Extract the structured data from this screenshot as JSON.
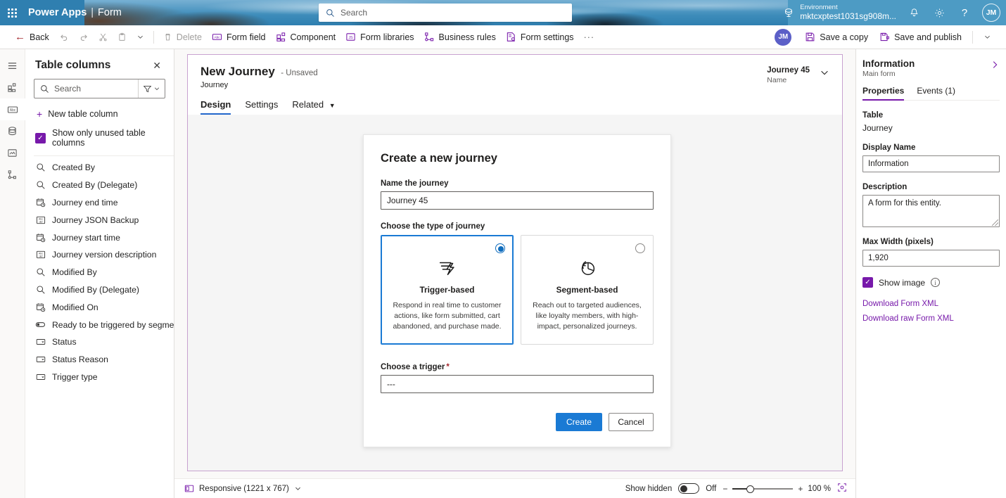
{
  "suitebar": {
    "waffle_label": "app-launcher",
    "brand": "Power Apps",
    "brand_separator": "|",
    "brand_sub": "Form",
    "search_placeholder": "Search",
    "environment_label": "Environment",
    "environment_name": "mktcxptest1031sg908m...",
    "avatar_initials": "JM"
  },
  "commandbar": {
    "back": "Back",
    "delete": "Delete",
    "form_field": "Form field",
    "component": "Component",
    "form_libraries": "Form libraries",
    "business_rules": "Business rules",
    "form_settings": "Form settings",
    "overflow": "···",
    "avatar_initials": "JM",
    "save_a_copy": "Save a copy",
    "save_and_publish": "Save and publish"
  },
  "rail": {
    "items": [
      {
        "name": "hamburger-icon",
        "label": "Menu"
      },
      {
        "name": "components-icon",
        "label": "Components"
      },
      {
        "name": "table-columns-icon",
        "label": "Table columns"
      },
      {
        "name": "data-sources-icon",
        "label": "Data sources"
      },
      {
        "name": "form-libraries-icon",
        "label": "Form libraries"
      },
      {
        "name": "business-rules-icon",
        "label": "Business rules"
      }
    ]
  },
  "columns_pane": {
    "title": "Table columns",
    "close_label": "Close",
    "search_placeholder": "Search",
    "new_column": "New table column",
    "show_unused_label": "Show only unused table columns",
    "show_unused_checked": true,
    "items": [
      {
        "label": "Created By",
        "icon": "lookup-icon"
      },
      {
        "label": "Created By (Delegate)",
        "icon": "lookup-icon"
      },
      {
        "label": "Journey end time",
        "icon": "datetime-icon"
      },
      {
        "label": "Journey JSON Backup",
        "icon": "text-icon"
      },
      {
        "label": "Journey start time",
        "icon": "datetime-icon"
      },
      {
        "label": "Journey version description",
        "icon": "text-icon"
      },
      {
        "label": "Modified By",
        "icon": "lookup-icon"
      },
      {
        "label": "Modified By (Delegate)",
        "icon": "lookup-icon"
      },
      {
        "label": "Modified On",
        "icon": "datetime-icon"
      },
      {
        "label": "Ready to be triggered by segment r...",
        "icon": "toggle-icon"
      },
      {
        "label": "Status",
        "icon": "choice-icon"
      },
      {
        "label": "Status Reason",
        "icon": "choice-icon"
      },
      {
        "label": "Trigger type",
        "icon": "choice-icon"
      }
    ]
  },
  "form": {
    "title": "New Journey",
    "unsaved": "- Unsaved",
    "subtitle": "Journey",
    "record_value": "Journey 45",
    "record_key": "Name",
    "tabs": [
      {
        "label": "Design",
        "active": true
      },
      {
        "label": "Settings",
        "active": false
      },
      {
        "label": "Related",
        "active": false,
        "chevron": true
      }
    ]
  },
  "dialog": {
    "title": "Create a new journey",
    "name_label": "Name the journey",
    "name_value": "Journey 45",
    "type_label": "Choose the type of journey",
    "cards": [
      {
        "title": "Trigger-based",
        "description": "Respond in real time to customer actions, like form submitted, cart abandoned, and purchase made.",
        "selected": true,
        "icon": "trigger-bolt-icon"
      },
      {
        "title": "Segment-based",
        "description": "Reach out to targeted audiences, like loyalty members, with high-impact, personalized journeys.",
        "selected": false,
        "icon": "segment-pie-icon"
      }
    ],
    "trigger_label": "Choose a trigger",
    "trigger_required": "*",
    "trigger_value": "---",
    "create_button": "Create",
    "cancel_button": "Cancel"
  },
  "properties": {
    "title": "Information",
    "subtitle": "Main form",
    "collapse_label": "Collapse",
    "tabs": [
      {
        "label": "Properties",
        "active": true
      },
      {
        "label": "Events (1)",
        "active": false
      }
    ],
    "table_label": "Table",
    "table_value": "Journey",
    "display_name_label": "Display Name",
    "display_name_value": "Information",
    "description_label": "Description",
    "description_value": "A form for this entity.",
    "max_width_label": "Max Width (pixels)",
    "max_width_value": "1,920",
    "show_image_label": "Show image",
    "show_image_checked": true,
    "links": [
      "Download Form XML",
      "Download raw Form XML"
    ]
  },
  "statusbar": {
    "responsive_label": "Responsive (1221 x 767)",
    "show_hidden_label": "Show hidden",
    "show_hidden_state": "Off",
    "zoom_minus": "−",
    "zoom_plus": "+",
    "zoom_value": "100 %",
    "fit_label": "fit-to-screen-icon"
  },
  "colors": {
    "accent_purple": "#7719aa",
    "accent_blue": "#1a7ad4",
    "suitebar_blue": "#2f7fb0",
    "required_red": "#a4262c"
  }
}
